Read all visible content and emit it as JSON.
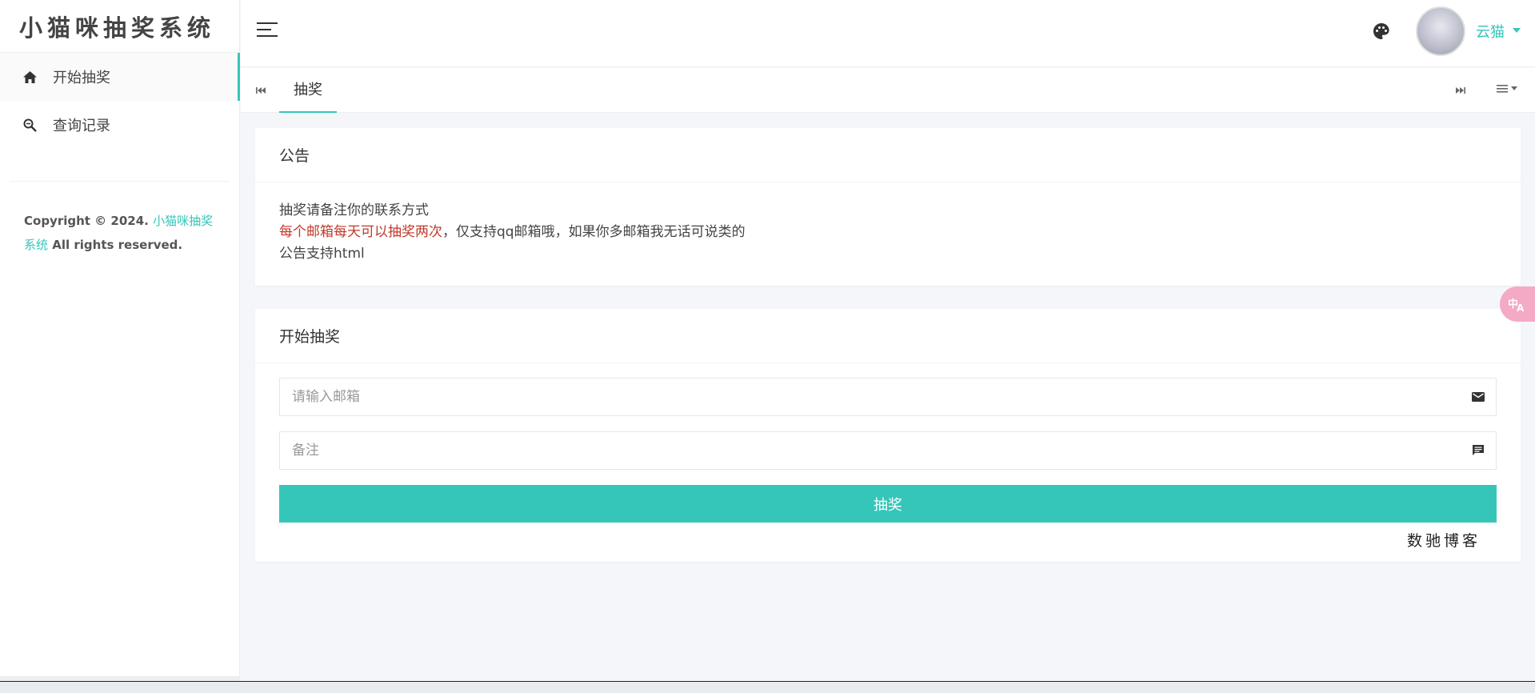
{
  "app": {
    "title": "小猫咪抽奖系统"
  },
  "sidebar": {
    "items": [
      {
        "label": "开始抽奖",
        "icon": "home-icon",
        "active": true
      },
      {
        "label": "查询记录",
        "icon": "search-icon",
        "active": false
      }
    ],
    "copyright": {
      "prefix": "Copyright © 2024.",
      "link": "小猫咪抽奖系统",
      "suffix": "All rights reserved."
    }
  },
  "header": {
    "username": "云猫",
    "accent_color": "#36c6b9"
  },
  "tabs": [
    {
      "label": "抽奖",
      "active": true
    }
  ],
  "notice": {
    "title": "公告",
    "line1": "抽奖请备注你的联系方式",
    "line2_red": "每个邮箱每天可以抽奖两次",
    "line2_rest": "，仅支持qq邮箱哦，如果你多邮箱我无话可说类的",
    "line3": "公告支持html"
  },
  "draw": {
    "title": "开始抽奖",
    "email_placeholder": "请输入邮箱",
    "note_placeholder": "备注",
    "button_label": "抽奖",
    "footer_text": "数驰博客"
  }
}
